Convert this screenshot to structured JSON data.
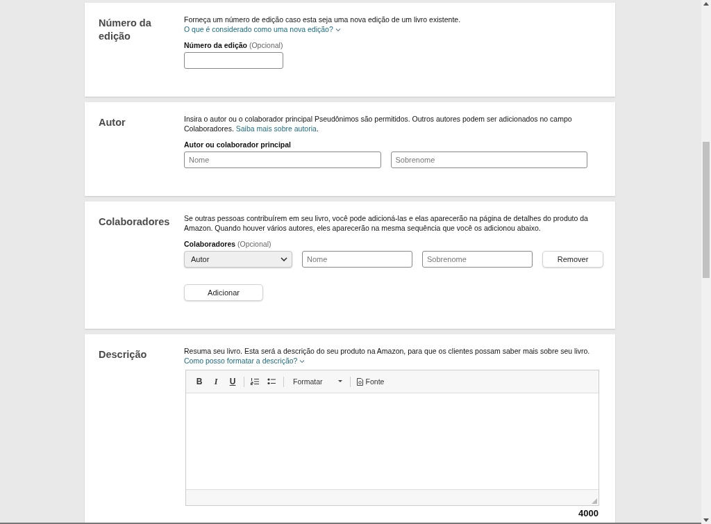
{
  "sections": [
    {
      "kind": "form",
      "title": "Número da edição",
      "description": "Forneça um número de edição caso esta seja uma nova edição de um livro existente.",
      "link": "O que é considerado como uma nova edição?",
      "link_caret": true,
      "label": "Número da edição",
      "label_note": "(Opcional)",
      "rows": [
        [
          {
            "kind": "input"
          }
        ]
      ]
    },
    {
      "kind": "form",
      "title": "Autor",
      "description": "Insira o autor ou o colaborador principal Pseudônimos são permitidos. Outros autores podem ser adicionados no campo Colaboradores.",
      "link": "Saiba mais sobre autoria",
      "link_caret": false,
      "after_link": ".",
      "label": "Autor ou colaborador principal",
      "rows": [
        [
          {
            "kind": "input",
            "placeholder": "Nome"
          },
          {
            "kind": "input",
            "placeholder": "Sobrenome"
          }
        ]
      ]
    },
    {
      "kind": "form",
      "title": "Colaboradores",
      "description": "Se outras pessoas contribuírem em seu livro, você pode adicioná-las e elas aparecerão na página de detalhes do produto da Amazon. Quando houver vários autores, eles aparecerão na mesma sequência que você os adicionou abaixo.",
      "label": "Colaboradores",
      "label_note": "(Opcional)",
      "rows": [
        [
          {
            "kind": "select",
            "value": "Autor"
          },
          {
            "kind": "input",
            "placeholder": "Nome"
          },
          {
            "kind": "input",
            "placeholder": "Sobrenome"
          },
          {
            "kind": "button",
            "label": "Remover"
          }
        ],
        [
          {
            "kind": "button",
            "label": "Adicionar"
          }
        ]
      ]
    },
    {
      "kind": "editor",
      "title": "Descrição",
      "description": "Resuma seu livro. Esta será a descrição do seu produto na Amazon, para que os clientes possam saber mais sobre seu livro.",
      "link": "Como posso formatar a descrição?",
      "link_caret": true,
      "toolbar": [
        {
          "kind": "bold",
          "label": "B"
        },
        {
          "kind": "italic",
          "label": "I"
        },
        {
          "kind": "underline",
          "label": "U"
        },
        {
          "kind": "separator"
        },
        {
          "kind": "ordered-list"
        },
        {
          "kind": "bullet-list"
        },
        {
          "kind": "separator"
        },
        {
          "kind": "dropdown",
          "label": "Formatar"
        },
        {
          "kind": "separator"
        },
        {
          "kind": "source",
          "label": "Fonte"
        }
      ],
      "counter": "4000"
    }
  ]
}
